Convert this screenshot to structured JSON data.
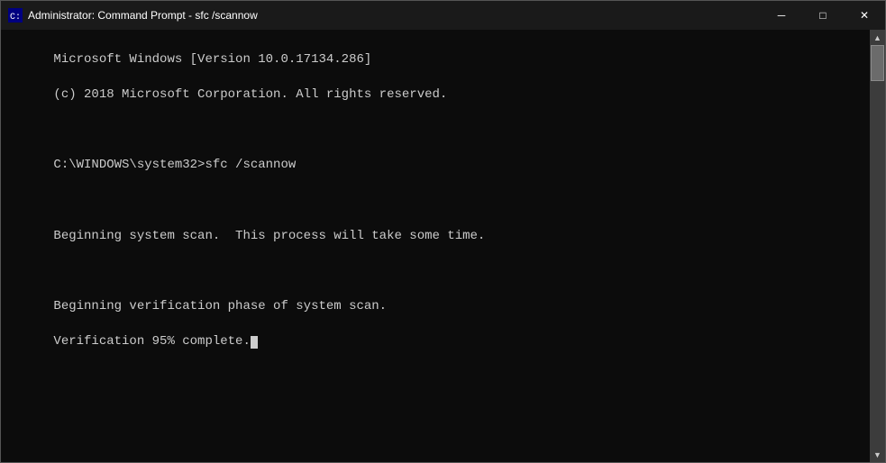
{
  "titlebar": {
    "title": "Administrator: Command Prompt - sfc /scannow",
    "minimize_label": "─",
    "maximize_label": "□",
    "close_label": "✕"
  },
  "terminal": {
    "lines": [
      "Microsoft Windows [Version 10.0.17134.286]",
      "(c) 2018 Microsoft Corporation. All rights reserved.",
      "",
      "C:\\WINDOWS\\system32>sfc /scannow",
      "",
      "Beginning system scan.  This process will take some time.",
      "",
      "Beginning verification phase of system scan.",
      "Verification 95% complete."
    ]
  },
  "scrollbar": {
    "up_arrow": "▲",
    "down_arrow": "▼"
  }
}
